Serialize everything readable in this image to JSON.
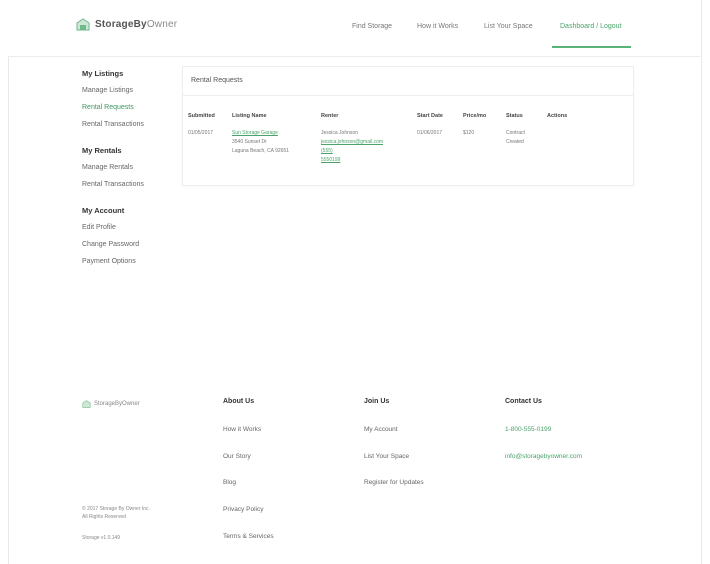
{
  "brand": {
    "name_bold": "StorageBy",
    "name_light": "Owner",
    "accent": "#4aa36b"
  },
  "nav": {
    "find_storage": "Find Storage",
    "how_it_works": "How it Works",
    "list_your_space": "List Your Space",
    "dashboard_user": "Dashboard / Logout"
  },
  "sidebar": {
    "listings": {
      "title": "My Listings",
      "items": [
        "Manage Listings",
        "Rental Requests",
        "Rental Transactions"
      ]
    },
    "rentals": {
      "title": "My Rentals",
      "items": [
        "Manage Rentals",
        "Rental Transactions"
      ]
    },
    "account": {
      "title": "My Account",
      "items": [
        "Edit Profile",
        "Change Password",
        "Payment Options"
      ]
    }
  },
  "main": {
    "card_title": "Rental Requests",
    "headers": [
      "Submitted",
      "Listing Name",
      "Renter",
      "Start Date",
      "Price/mo",
      "Status",
      "Actions"
    ],
    "row": {
      "submitted": "01/05/2017",
      "listing_name": "Sun Storage Garage",
      "address_1": "3540 Sunset Dr",
      "address_2": "Laguna Beach, CA 92651",
      "renter_name": "Jessica Johnson",
      "renter_email": "jessica.johnson@gmail.com",
      "renter_phone": "(555)",
      "renter_extra": "5550199",
      "start_date": "01/06/2017",
      "price": "$120",
      "status_1": "Contract",
      "status_2": "Created",
      "actions": ""
    }
  },
  "footer": {
    "logo_text": "StorageByOwner",
    "about": {
      "title": "About Us",
      "links": [
        "How it Works",
        "Our Story",
        "Blog",
        "Privacy Policy",
        "Terms & Services"
      ]
    },
    "join": {
      "title": "Join Us",
      "links": [
        "My Account",
        "List Your Space",
        "Register for Updates"
      ]
    },
    "contact": {
      "title": "Contact Us",
      "phone": "1-800-555-0199",
      "email": "info@storagebyowner.com"
    },
    "copyright_1": "© 2017 Storage By Owner Inc.",
    "copyright_2": "All Rights Reserved",
    "version": "Storage v1.0.149"
  }
}
